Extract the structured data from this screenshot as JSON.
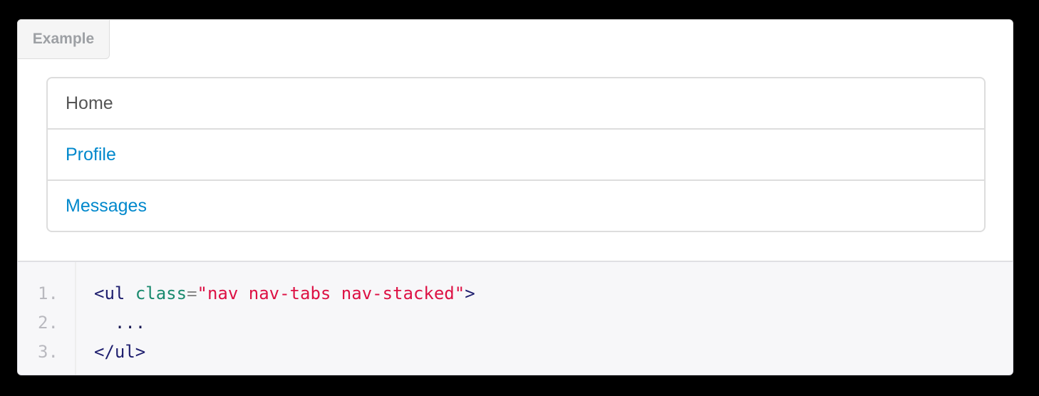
{
  "example": {
    "label": "Example",
    "nav_items": [
      {
        "label": "Home",
        "state": "active"
      },
      {
        "label": "Profile",
        "state": "link"
      },
      {
        "label": "Messages",
        "state": "link"
      }
    ]
  },
  "code": {
    "line_numbers": [
      "1.",
      "2.",
      "3."
    ],
    "line1": {
      "open": "<ul",
      "space": " ",
      "attr": "class",
      "eq": "=",
      "value": "\"nav nav-tabs nav-stacked\"",
      "close": ">"
    },
    "line2": "  ...",
    "line3": "</ul>"
  },
  "colors": {
    "link": "#0088cc",
    "active_text": "#555555",
    "string": "#dd1144",
    "attribute": "#1a8a6e",
    "tag": "#1e1e6e"
  }
}
